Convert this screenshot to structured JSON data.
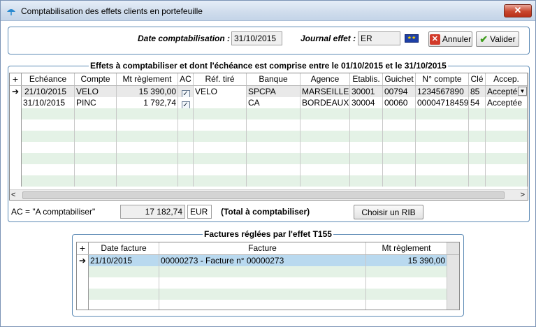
{
  "window": {
    "title": "Comptabilisation des effets clients en portefeuille",
    "close_label": "✕"
  },
  "header": {
    "date_label": "Date comptabilisation :",
    "date_value": "31/10/2015",
    "journal_label": "Journal effet :",
    "journal_value": "ER",
    "annuler_label": "Annuler",
    "valider_label": "Valider"
  },
  "effets": {
    "title": "Effets à comptabiliser et dont l'échéance est comprise entre le 01/10/2015 et le 31/10/2015",
    "add_glyph": "+",
    "columns": [
      "Echéance",
      "Compte",
      "Mt règlement",
      "AC",
      "Réf. tiré",
      "Banque",
      "Agence",
      "Etablis.",
      "Guichet",
      "N° compte",
      "Clé",
      "Accep."
    ],
    "rows": [
      {
        "indicator": "➔",
        "echeance": "21/10/2015",
        "compte": "VELO",
        "montant": "15 390,00",
        "ac": "✓",
        "ref": "VELO",
        "banque": "SPCPA",
        "agence": "MARSEILLE",
        "etablis": "30001",
        "guichet": "00794",
        "compte_no": "1234567890",
        "cle": "85",
        "accep": "Acceptée"
      },
      {
        "indicator": "",
        "echeance": "31/10/2015",
        "compte": "PINC",
        "montant": "1 792,74",
        "ac": "✓",
        "ref": "",
        "banque": "CA",
        "agence": "BORDEAUX",
        "etablis": "30004",
        "guichet": "00060",
        "compte_no": "00004718459",
        "cle": "54",
        "accep": "Acceptée"
      }
    ],
    "scroll_left": "<",
    "scroll_right": ">"
  },
  "footer": {
    "ac_label": "AC = \"A comptabiliser\"",
    "total_value": "17 182,74",
    "currency": "EUR",
    "total_label": "(Total à comptabiliser)",
    "rib_button": "Choisir un RIB"
  },
  "factures": {
    "title": "Factures réglées par l'effet T155",
    "add_glyph": "+",
    "columns": [
      "Date facture",
      "Facture",
      "Mt règlement"
    ],
    "rows": [
      {
        "indicator": "➔",
        "date": "21/10/2015",
        "facture": "00000273 - Facture n° 00000273",
        "montant": "15 390,00"
      }
    ]
  },
  "colors": {
    "accent": "#5c8ab5",
    "alt_row": "#e4f2e6",
    "selected_row": "#b9d9ef"
  }
}
